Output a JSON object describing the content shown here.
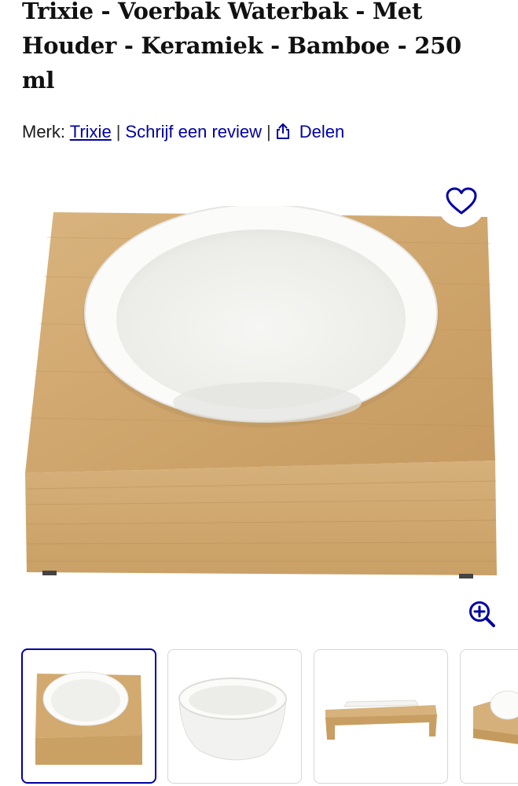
{
  "product": {
    "title": "Trixie - Voerbak Waterbak - Met Houder - Keramiek - Bamboe - 250 ml"
  },
  "meta": {
    "brand_label": "Merk:",
    "brand_name": "Trixie",
    "separator": "|",
    "review_link": "Schrijf een review",
    "share_label": "Delen"
  },
  "icons": {
    "favorite": "heart-outline-icon",
    "share": "share-icon",
    "zoom": "zoom-in-icon"
  },
  "colors": {
    "link": "#0000a4",
    "title": "#111111",
    "active_thumb_border": "#0000a4"
  },
  "gallery": {
    "thumbnails": [
      {
        "name": "thumb-1",
        "active": true
      },
      {
        "name": "thumb-2",
        "active": false
      },
      {
        "name": "thumb-3",
        "active": false
      },
      {
        "name": "thumb-4",
        "active": false
      }
    ]
  }
}
